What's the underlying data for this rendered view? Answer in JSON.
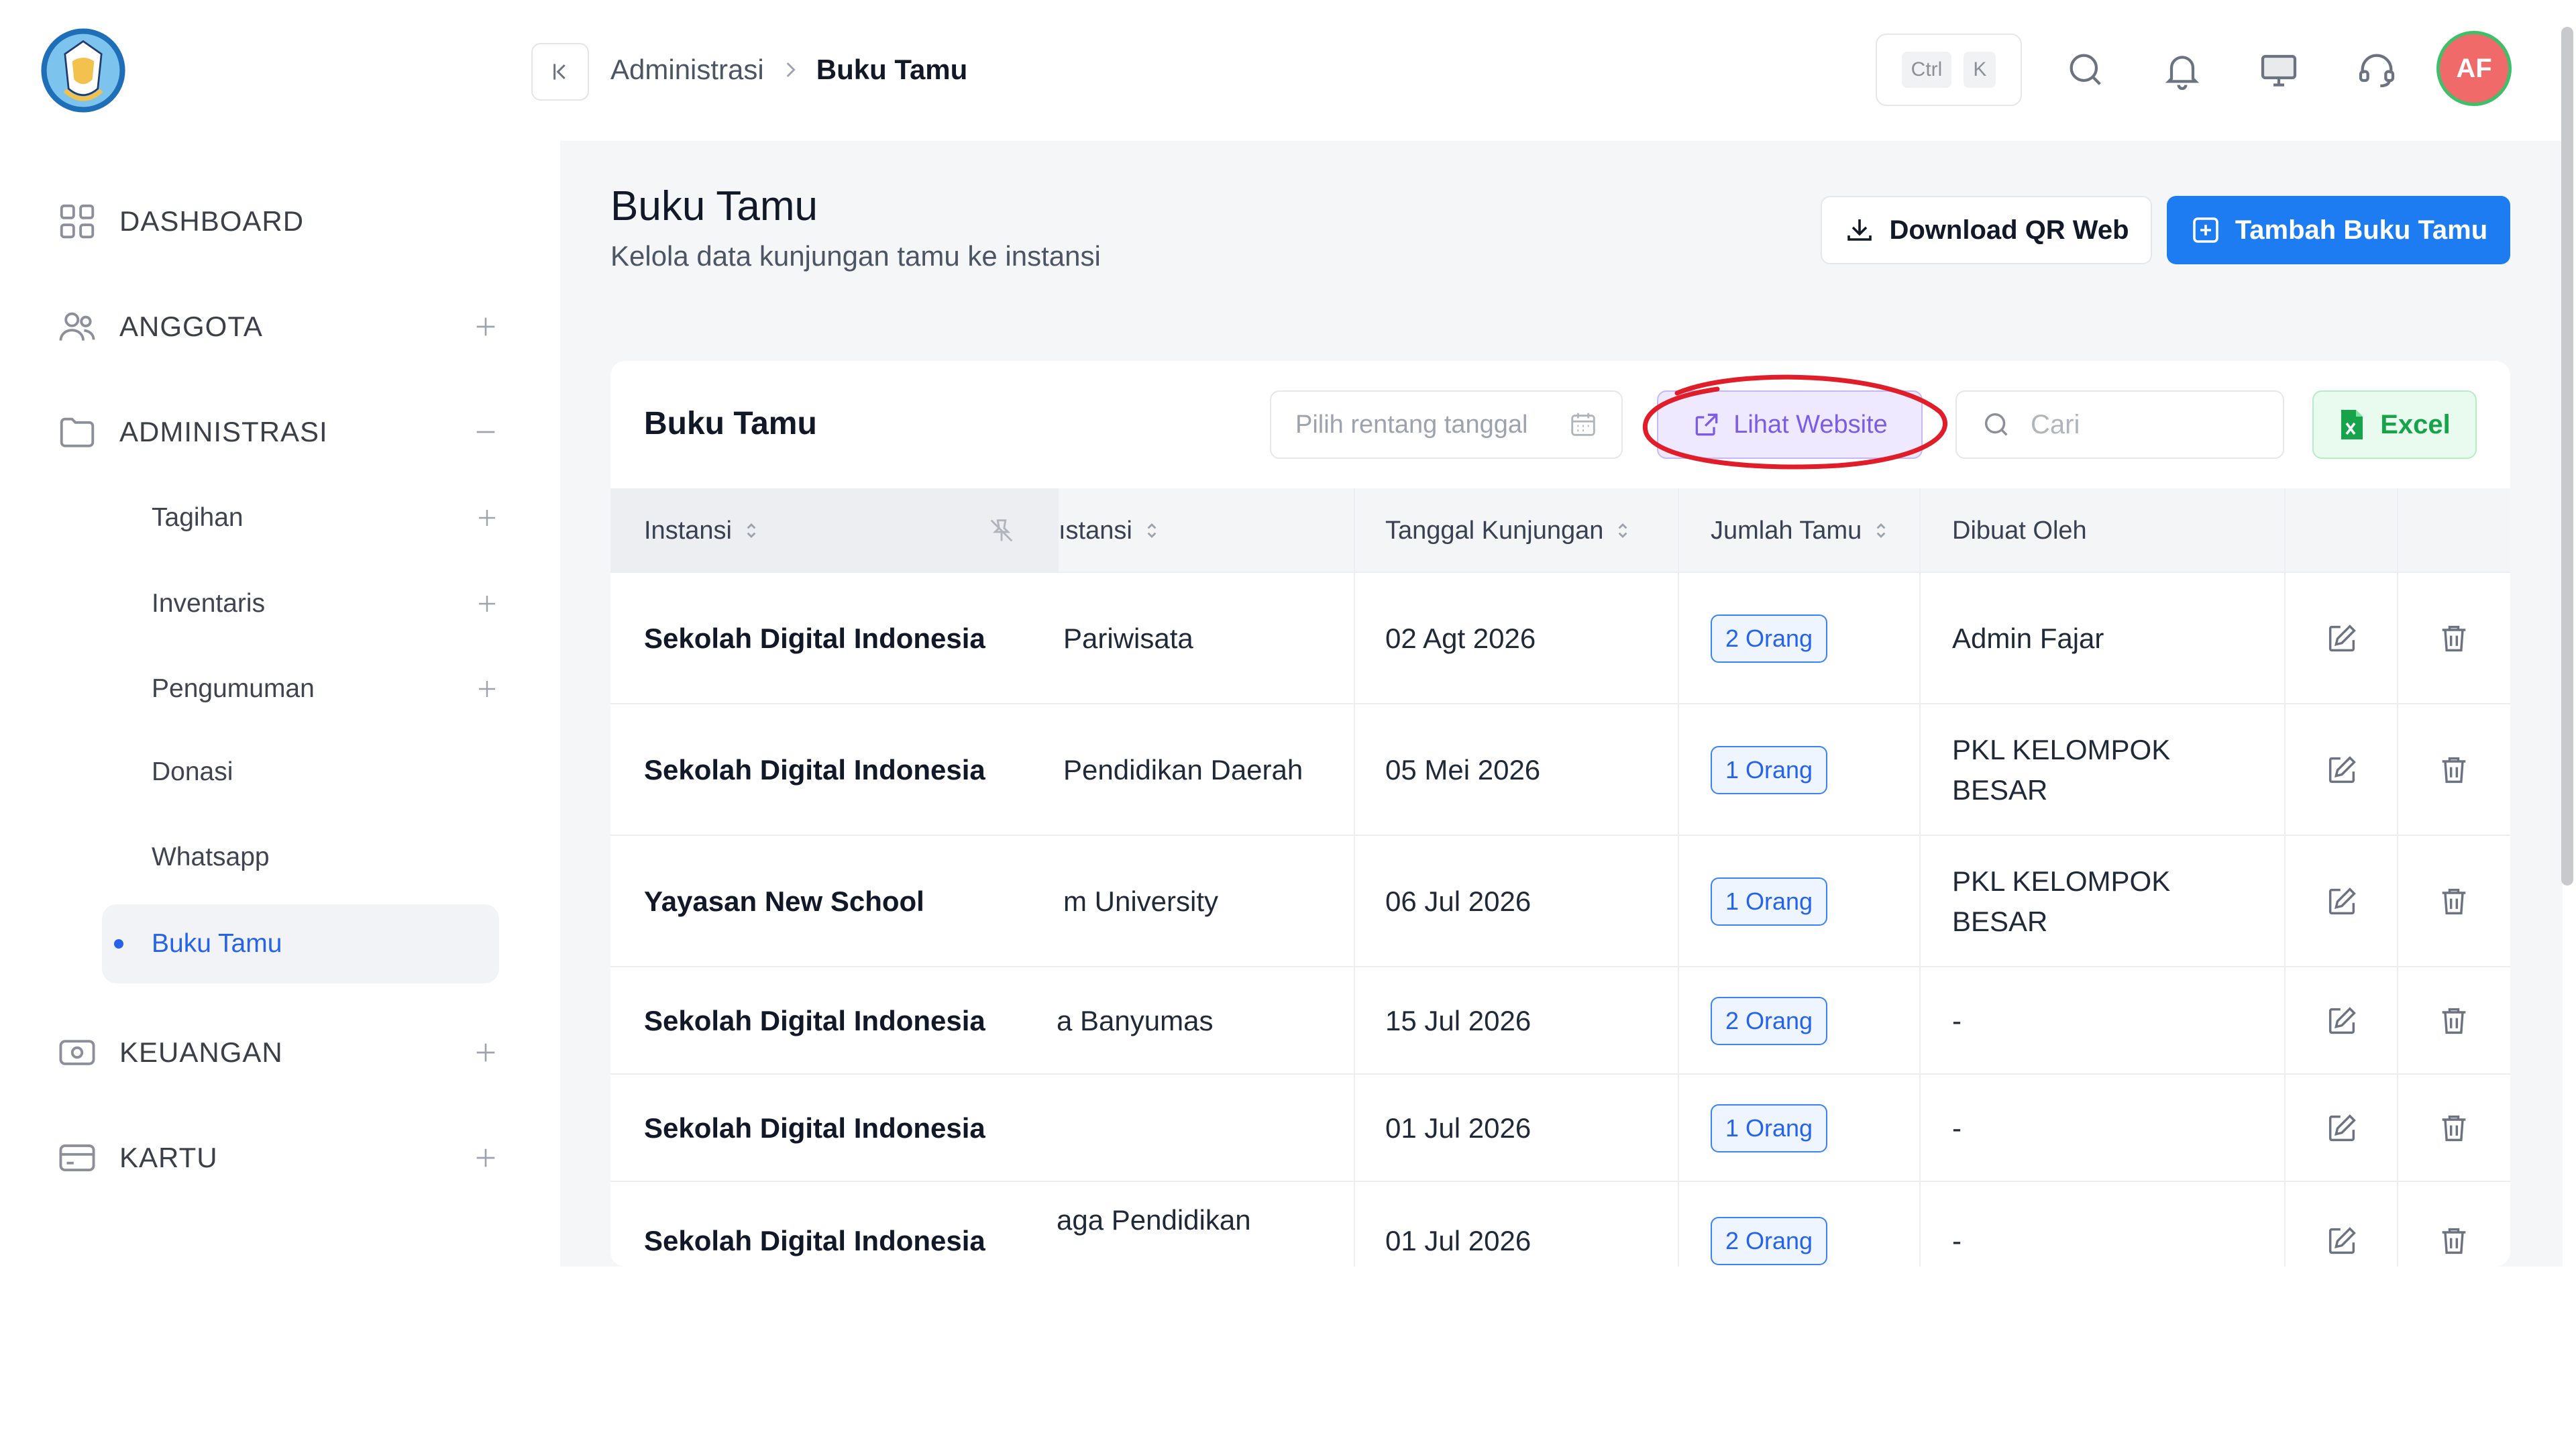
{
  "sidebar": {
    "logo": "tut-wuri-handayani-logo",
    "items": [
      {
        "label": "DASHBOARD",
        "icon": "grid-icon"
      },
      {
        "label": "ANGGOTA",
        "icon": "users-icon"
      },
      {
        "label": "ADMINISTRASI",
        "icon": "folder-icon"
      },
      {
        "label": "KEUANGAN",
        "icon": "money-icon"
      },
      {
        "label": "KARTU",
        "icon": "card-icon"
      }
    ],
    "subitems": [
      {
        "label": "Tagihan"
      },
      {
        "label": "Inventaris"
      },
      {
        "label": "Pengumuman"
      },
      {
        "label": "Donasi"
      },
      {
        "label": "Whatsapp"
      },
      {
        "label": "Buku Tamu",
        "active": true
      }
    ]
  },
  "topbar": {
    "breadcrumb": [
      "Administrasi",
      "Buku Tamu"
    ],
    "shortcut": [
      "Ctrl",
      "K"
    ],
    "avatar_initials": "AF"
  },
  "page": {
    "title": "Buku Tamu",
    "subtitle": "Kelola data kunjungan tamu ke instansi",
    "download_button": "Download QR Web",
    "add_button": "Tambah Buku Tamu"
  },
  "card": {
    "title": "Buku Tamu",
    "date_placeholder": "Pilih rentang tanggal",
    "lihat_button": "Lihat Website",
    "search_placeholder": "Cari",
    "excel_button": "Excel"
  },
  "table": {
    "columns": [
      "Instansi",
      "ıstansi",
      "Tanggal Kunjungan",
      "Jumlah Tamu",
      "Dibuat Oleh"
    ],
    "rows": [
      {
        "instansi": "Sekolah Digital Indonesia",
        "tujuan": "Pariwisata",
        "tanggal": "02 Agt 2026",
        "jumlah": "2 Orang",
        "oleh": "Admin Fajar"
      },
      {
        "instansi": "Sekolah Digital Indonesia",
        "tujuan": "Pendidikan Daerah",
        "tanggal": "05 Mei 2026",
        "jumlah": "1 Orang",
        "oleh": "PKL KELOMPOK BESAR"
      },
      {
        "instansi": "Yayasan New School",
        "tujuan": "m University",
        "tanggal": "06 Jul 2026",
        "jumlah": "1 Orang",
        "oleh": "PKL KELOMPOK BESAR"
      },
      {
        "instansi": "Sekolah Digital Indonesia",
        "tujuan": "a Banyumas",
        "tanggal": "15 Jul 2026",
        "jumlah": "2 Orang",
        "oleh": "-"
      },
      {
        "instansi": "Sekolah Digital Indonesia",
        "tujuan": "",
        "tanggal": "01 Jul 2026",
        "jumlah": "1 Orang",
        "oleh": "-"
      },
      {
        "instansi": "Sekolah Digital Indonesia",
        "tujuan": "aga Pendidikan",
        "tanggal": "01 Jul 2026",
        "jumlah": "2 Orang",
        "oleh": "-"
      }
    ]
  },
  "colors": {
    "primary": "#1d7cf2",
    "lihat_bg": "#efe9ff",
    "excel": "#16a34a",
    "annotation": "#e11d2a"
  }
}
